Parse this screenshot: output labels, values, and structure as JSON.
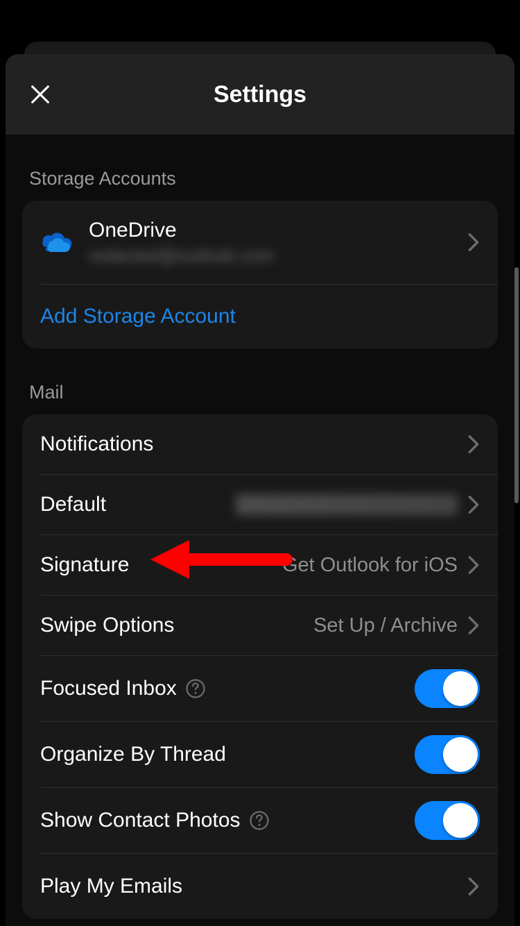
{
  "header": {
    "title": "Settings"
  },
  "sections": {
    "storage": {
      "label": "Storage Accounts",
      "onedrive": {
        "title": "OneDrive",
        "subtitle": "redacted@outlook.com"
      },
      "add": "Add Storage Account"
    },
    "mail": {
      "label": "Mail",
      "notifications": "Notifications",
      "defaultLabel": "Default",
      "defaultValue": "redacted@outlook.com",
      "signatureLabel": "Signature",
      "signatureValue": "Get Outlook for iOS",
      "swipeLabel": "Swipe Options",
      "swipeValue": "Set Up / Archive",
      "focusedInbox": "Focused Inbox",
      "organizeThread": "Organize By Thread",
      "showContactPhotos": "Show Contact Photos",
      "playMyEmails": "Play My Emails"
    }
  },
  "colors": {
    "accent": "#0a84ff",
    "link": "#1b86e8"
  }
}
